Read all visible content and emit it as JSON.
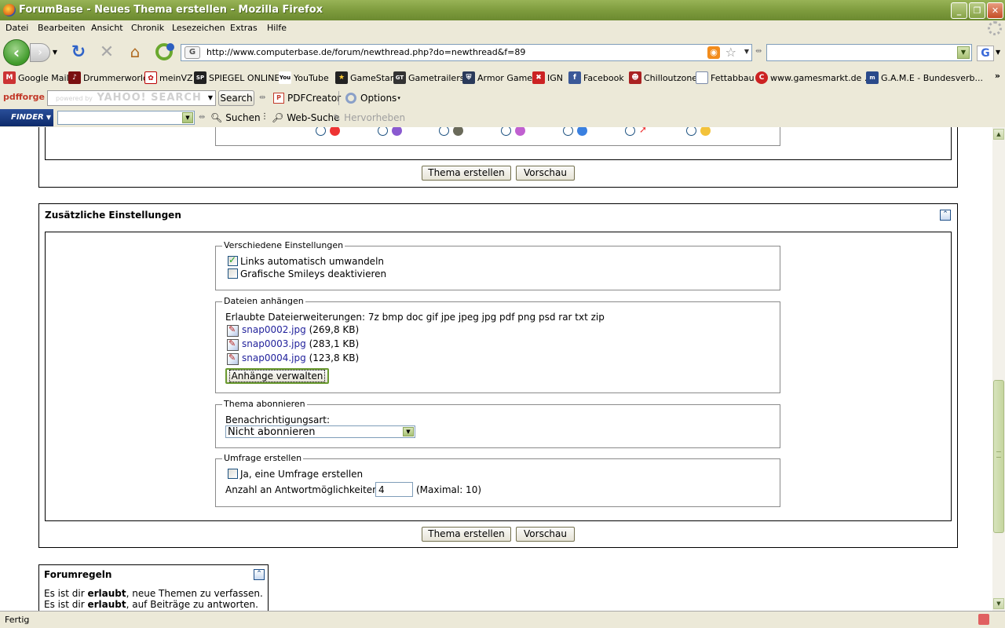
{
  "window": {
    "title": "ForumBase - Neues Thema erstellen - Mozilla Firefox"
  },
  "menu": [
    "Datei",
    "Bearbeiten",
    "Ansicht",
    "Chronik",
    "Lesezeichen",
    "Extras",
    "Hilfe"
  ],
  "nav": {
    "url": "http://www.computerbase.de/forum/newthread.php?do=newthread&f=89",
    "search_value": ""
  },
  "bookmarks": [
    "Google Mail",
    "Drummerworld",
    "meinVZ",
    "SPIEGEL ONLINE",
    "YouTube",
    "GameStar",
    "Gametrailers",
    "Armor Games",
    "IGN",
    "Facebook",
    "Chilloutzone",
    "Fettabbau",
    "www.gamesmarkt.de ...",
    "G.A.M.E - Bundesverb..."
  ],
  "toolbar_pdf": {
    "brand": "pdfforge",
    "search_placeholder_small": "powered by",
    "search_placeholder": "YAHOO! SEARCH",
    "search_button": "Search",
    "pdfcreator": "PDFCreator",
    "options": "Options"
  },
  "toolbar_finder": {
    "logo": "FINDER",
    "search": "Suchen",
    "web_search": "Web-Suche",
    "highlight": "Hervorheben"
  },
  "form": {
    "create_button": "Thema erstellen",
    "preview_button": "Vorschau"
  },
  "settings": {
    "title": "Zusätzliche Einstellungen",
    "misc_legend": "Verschiedene Einstellungen",
    "auto_links": "Links automatisch umwandeln",
    "auto_links_checked": true,
    "disable_smileys": "Grafische Smileys deaktivieren",
    "disable_smileys_checked": false,
    "attach_legend": "Dateien anhängen",
    "allowed_ext": "Erlaubte Dateierweiterungen: 7z bmp doc gif jpe jpeg jpg pdf png psd rar txt zip",
    "files": [
      {
        "name": "snap0002.jpg",
        "size": "(269,8 KB)"
      },
      {
        "name": "snap0003.jpg",
        "size": "(283,1 KB)"
      },
      {
        "name": "snap0004.jpg",
        "size": "(123,8 KB)"
      }
    ],
    "manage_attachments": "Anhänge verwalten",
    "subscribe_legend": "Thema abonnieren",
    "notify_label": "Benachrichtigungsart:",
    "notify_value": "Nicht abonnieren",
    "poll_legend": "Umfrage erstellen",
    "poll_checkbox": "Ja, eine Umfrage erstellen",
    "poll_checked": false,
    "poll_count_label": "Anzahl an Antwortmöglichkeiten:",
    "poll_count_value": "4",
    "poll_max": "(Maximal: 10)"
  },
  "rules": {
    "title": "Forumregeln",
    "line1_prefix": "Es ist dir ",
    "line1_bold": "erlaubt",
    "line1_suffix": ", neue Themen zu verfassen.",
    "line2_prefix": "Es ist dir ",
    "line2_bold": "erlaubt",
    "line2_suffix": ", auf Beiträge zu antworten."
  },
  "status": {
    "text": "Fertig"
  },
  "colors": {
    "titlebar": "#7c9a3c",
    "link": "#22229c",
    "window_bg": "#ece9d8"
  }
}
